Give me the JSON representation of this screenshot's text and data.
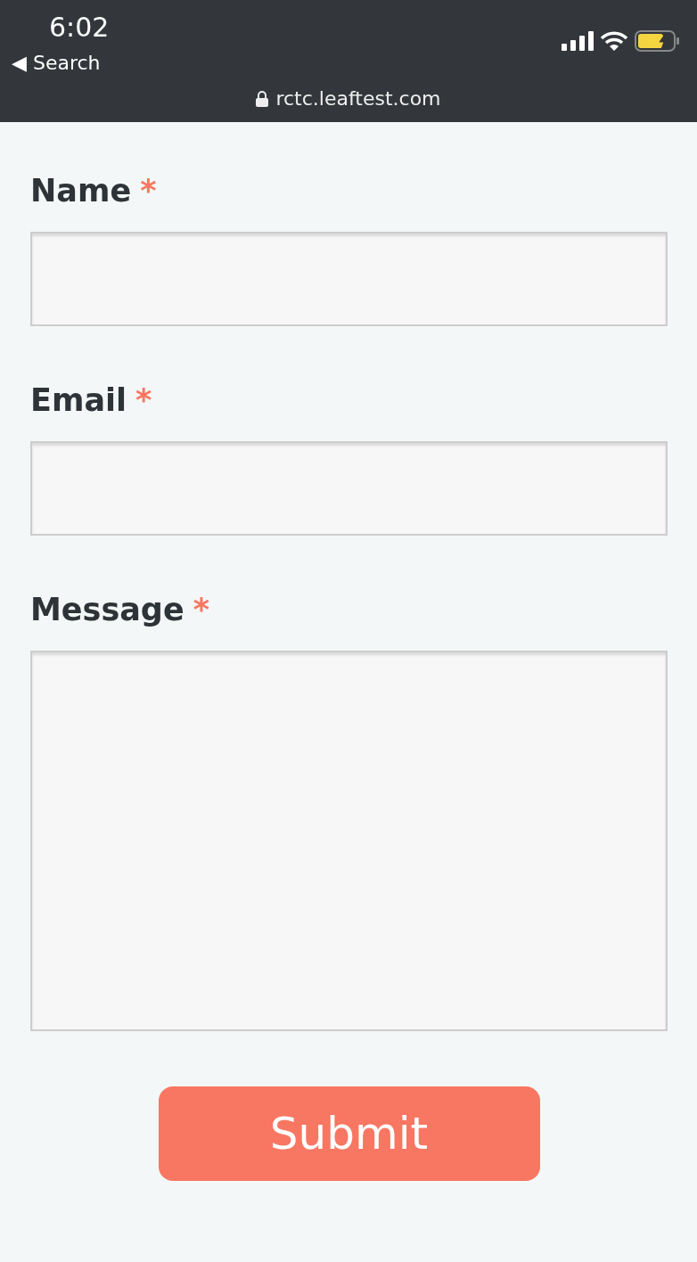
{
  "status_bar": {
    "time": "6:02",
    "back_arrow": "◀",
    "back_label": "Search",
    "url": "rctc.leaftest.com",
    "battery_charging": true
  },
  "form": {
    "fields": [
      {
        "label": "Name",
        "required_mark": "*",
        "kind": "input"
      },
      {
        "label": "Email",
        "required_mark": "*",
        "kind": "input"
      },
      {
        "label": "Message",
        "required_mark": "*",
        "kind": "textarea"
      }
    ],
    "submit": "Submit"
  }
}
